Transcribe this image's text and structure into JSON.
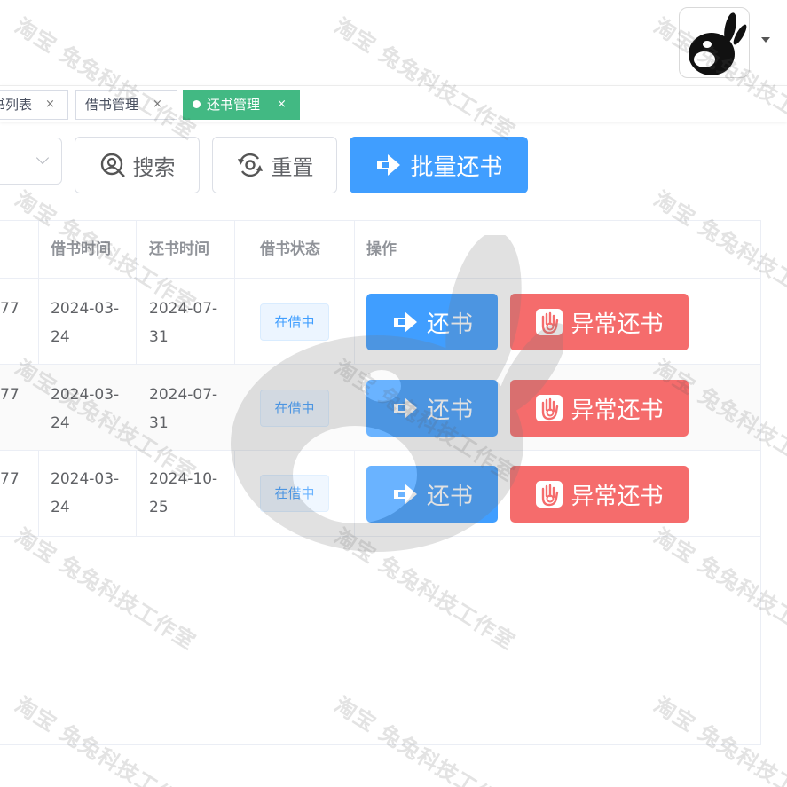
{
  "tags": [
    {
      "label": "书列表",
      "close": "×"
    },
    {
      "label": "借书管理",
      "close": "×"
    },
    {
      "label": "还书管理",
      "close": "×"
    }
  ],
  "search": {
    "search_label": "搜索",
    "reset_label": "重置",
    "batch_return_label": "批量还书"
  },
  "table": {
    "headers": {
      "borrow_time": "借书时间",
      "return_time": "还书时间",
      "status": "借书状态",
      "actions": "操作"
    },
    "rows": [
      {
        "id_tail": "77",
        "borrow_date_1": "2024-03-",
        "borrow_date_2": "24",
        "return_date_1": "2024-07-",
        "return_date_2": "31",
        "status": "在借中",
        "return_label": "还书",
        "abnormal_label": "异常还书"
      },
      {
        "id_tail": "77",
        "borrow_date_1": "2024-03-",
        "borrow_date_2": "24",
        "return_date_1": "2024-07-",
        "return_date_2": "31",
        "status": "在借中",
        "return_label": "还书",
        "abnormal_label": "异常还书"
      },
      {
        "id_tail": "77",
        "borrow_date_1": "2024-03-",
        "borrow_date_2": "24",
        "return_date_1": "2024-10-",
        "return_date_2": "25",
        "status": "在借中",
        "return_label": "还书",
        "abnormal_label": "异常还书"
      }
    ]
  },
  "watermark": "淘宝 兔兔科技工作室",
  "colors": {
    "primary": "#409eff",
    "danger": "#f56c6c",
    "tag_active": "#42b983",
    "status_bg": "#ecf5ff"
  },
  "icons": {
    "avatar": "bunny-logo",
    "dropdown": "caret-down-icon",
    "search": "search-icon",
    "reset": "refresh-icon",
    "return": "arrow-right-icon",
    "abnormal": "hand-stop-icon"
  }
}
